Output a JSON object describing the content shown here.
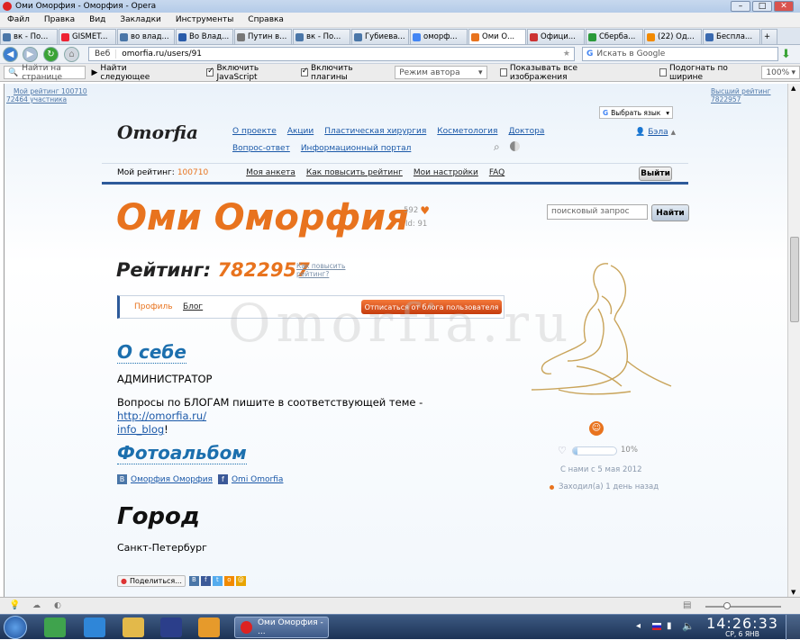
{
  "window": {
    "title": "Оми Оморфия - Оморфия - Opera",
    "min": "–",
    "max": "□",
    "close": "✕"
  },
  "menu": [
    "Файл",
    "Правка",
    "Вид",
    "Закладки",
    "Инструменты",
    "Справка"
  ],
  "tabs": [
    {
      "label": "вк - По...",
      "color": "#4a76a8"
    },
    {
      "label": "GISMET...",
      "color": "#e23"
    },
    {
      "label": "во влад...",
      "color": "#4a76a8"
    },
    {
      "label": "Во Влад...",
      "color": "#2a5caa"
    },
    {
      "label": "Путин в...",
      "color": "#777"
    },
    {
      "label": "вк - По...",
      "color": "#4a76a8"
    },
    {
      "label": "Губиева...",
      "color": "#4a76a8"
    },
    {
      "label": "оморф...",
      "color": "#4285f4"
    },
    {
      "label": "Оми О...",
      "color": "#e8731e",
      "active": true
    },
    {
      "label": "Офици...",
      "color": "#c33"
    },
    {
      "label": "Сберба...",
      "color": "#2a9a3a"
    },
    {
      "label": "(22) Од...",
      "color": "#f28a00"
    },
    {
      "label": "Беспла...",
      "color": "#3a6ab0"
    }
  ],
  "address": {
    "web_label": "Веб",
    "url": "omorfia.ru/users/91",
    "search_placeholder": "Искать в Google"
  },
  "findbar": {
    "find_placeholder": "Найти на странице",
    "find_next": "Найти следующее",
    "js": "Включить JavaScript",
    "plugins": "Включить плагины",
    "author_mode": "Режим автора",
    "show_images": "Показывать все изображения",
    "fit_width": "Подогнать по ширине",
    "zoom": "100%"
  },
  "site": {
    "top_left_rating": "Мой рейтинг 100710",
    "top_left_members": "72464 участника",
    "top_right": "Высший рейтинг 7822957",
    "logo": "Omorfia",
    "nav_row1": [
      "О проекте",
      "Акции",
      "Пластическая хирургия",
      "Косметология",
      "Доктора"
    ],
    "nav_row2": [
      "Вопрос-ответ",
      "Информационный портал"
    ],
    "lang_button": "Выбрать язык",
    "user_name": "Бэла",
    "my_rating_label": "Мой рейтинг:",
    "my_rating_value": "100710",
    "user_links": [
      "Моя анкета",
      "Как повысить рейтинг",
      "Мои настройки",
      "FAQ"
    ],
    "logout": "Выйти",
    "search_placeholder": "поисковый запрос",
    "search_button": "Найти"
  },
  "profile": {
    "name": "Оми Оморфия",
    "likes": "592",
    "id": "Id: 91",
    "rating_label": "Рейтинг:",
    "rating_value": "7822957",
    "how_raise_1": "Как повысить",
    "how_raise_2": "рейтинг?",
    "tab_profile": "Профиль",
    "tab_blog": "Блог",
    "unsubscribe": "Отписаться от блога пользователя",
    "about_title": "О себе",
    "about_role": "АДМИНИСТРАТОР",
    "about_text": "Вопросы по БЛОГАМ пишите в соответствующей теме - ",
    "about_link_1": "http://omorfia.ru/",
    "about_link_2": "info_blog",
    "about_end": "!",
    "photo_title": "Фотоальбом",
    "photo_vk": "Оморфия Оморфия",
    "photo_fb": "Omi Omorfia",
    "city_title": "Город",
    "city": "Санкт-Петербург",
    "share": "Поделиться...",
    "progress_percent": 10,
    "progress_label": "10%",
    "since": "С нами с 5 мая 2012",
    "last_visit": "Заходил(а) 1 день назад",
    "watermark": "Omorfia.ru"
  },
  "taskbar": {
    "active_window": "Оми Оморфия - ...",
    "time": "14:26:33",
    "date": "СР, 6  ЯНВ"
  }
}
